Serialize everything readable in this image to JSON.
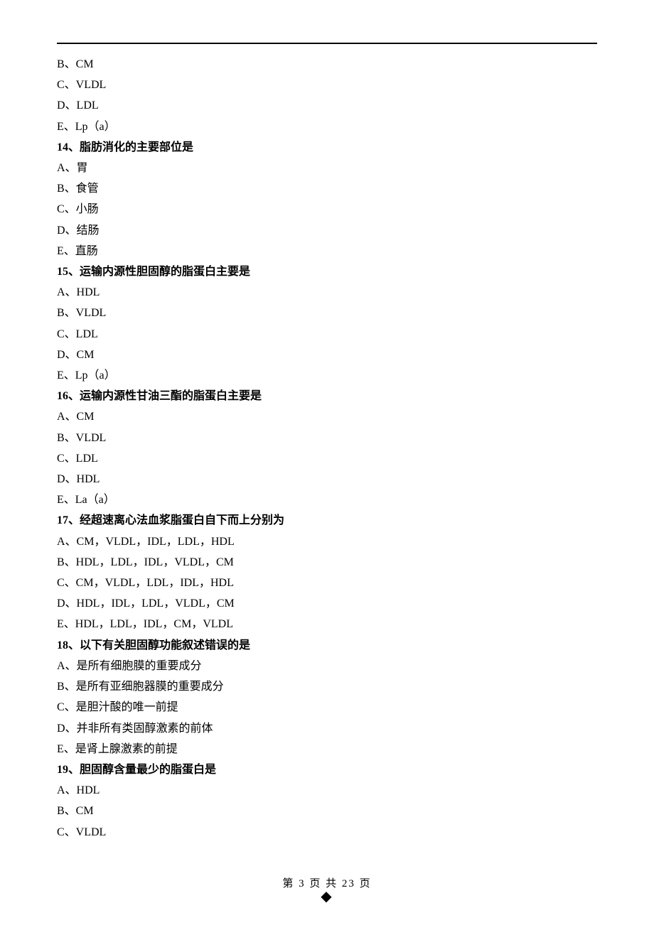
{
  "pre_options": [
    "B、CM",
    "C、VLDL",
    "D、LDL",
    "E、Lp（a）"
  ],
  "questions": [
    {
      "head": "14、脂肪消化的主要部位是",
      "opts": [
        "A、胃",
        "B、食管",
        "C、小肠",
        "D、结肠",
        "E、直肠"
      ]
    },
    {
      "head": "15、运输内源性胆固醇的脂蛋白主要是",
      "opts": [
        "A、HDL",
        "B、VLDL",
        "C、LDL",
        "D、CM",
        "E、Lp（a）"
      ]
    },
    {
      "head": "16、运输内源性甘油三酯的脂蛋白主要是",
      "opts": [
        "A、CM",
        "B、VLDL",
        "C、LDL",
        "D、HDL",
        "E、La（a）"
      ]
    },
    {
      "head": "17、经超速离心法血浆脂蛋白自下而上分别为",
      "opts": [
        "A、CM，VLDL，IDL，LDL，HDL",
        "B、HDL，LDL，IDL，VLDL，CM",
        "C、CM，VLDL，LDL，IDL，HDL",
        "D、HDL，IDL，LDL，VLDL，CM",
        "E、HDL，LDL，IDL，CM，VLDL"
      ]
    },
    {
      "head": "18、以下有关胆固醇功能叙述错误的是",
      "opts": [
        "A、是所有细胞膜的重要成分",
        "B、是所有亚细胞器膜的重要成分",
        "C、是胆汁酸的唯一前提",
        "D、并非所有类固醇激素的前体",
        "E、是肾上腺激素的前提"
      ]
    },
    {
      "head": "19、胆固醇含量最少的脂蛋白是",
      "opts": [
        "A、HDL",
        "B、CM",
        "C、VLDL"
      ]
    }
  ],
  "footer": {
    "text": "第 3 页 共 23 页",
    "dot": "◆"
  }
}
